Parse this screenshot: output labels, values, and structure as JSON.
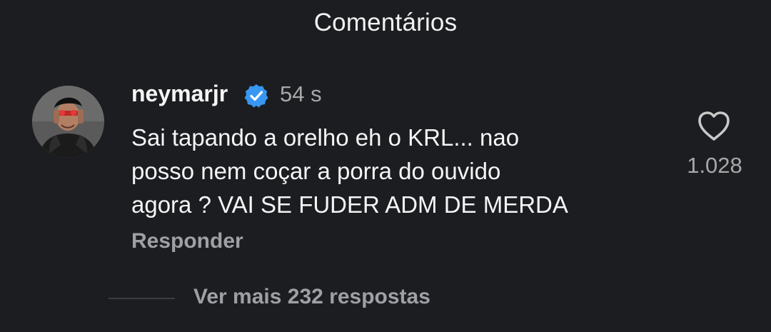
{
  "header": {
    "title": "Comentários"
  },
  "comment": {
    "username": "neymarjr",
    "verified_icon": "verified-badge-icon",
    "timestamp": "54 s",
    "text_lines": [
      "Sai tapando a orelho eh o KRL... nao",
      "posso nem coçar a porra do ouvido",
      "agora ? VAI SE FUDER ADM DE MERDA"
    ],
    "reply_label": "Responder",
    "likes": "1.028",
    "like_icon": "heart-outline-icon"
  },
  "replies": {
    "view_more_label": "Ver mais 232 respostas"
  },
  "colors": {
    "background": "#1c1d21",
    "primary_text": "#f5f5f5",
    "secondary_text": "#a8a8a8",
    "verified_blue": "#3897f0"
  }
}
